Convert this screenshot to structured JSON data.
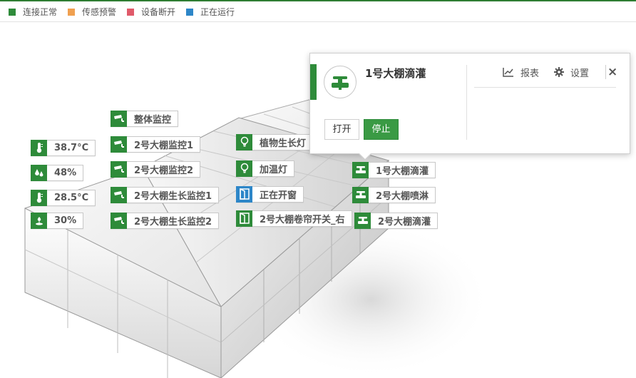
{
  "legend": [
    {
      "label": "连接正常",
      "color": "#2e8b3a"
    },
    {
      "label": "传感预警",
      "color": "#f0a050"
    },
    {
      "label": "设备断开",
      "color": "#e05a6a"
    },
    {
      "label": "正在运行",
      "color": "#2d86c8"
    }
  ],
  "sensors": {
    "temp1": {
      "value": "38.7°C",
      "icon": "thermometer-icon"
    },
    "hum1": {
      "value": "48%",
      "icon": "water-drops-icon"
    },
    "temp2": {
      "value": "28.5°C",
      "icon": "thermometer-icon"
    },
    "soil": {
      "value": "30%",
      "icon": "plant-moisture-icon"
    }
  },
  "monitors": {
    "overall": "整体监控",
    "m1": "2号大棚监控1",
    "m2": "2号大棚监控2",
    "g1": "2号大棚生长监控1",
    "g2": "2号大棚生长监控2"
  },
  "devices": {
    "plant_light": "植物生长灯",
    "heat_lamp": "加温灯",
    "window": "正在开窗",
    "curtain": "2号大棚卷帘开关_右",
    "drip1": "1号大棚滴灌",
    "spray2": "2号大棚喷淋",
    "drip2": "2号大棚滴灌"
  },
  "popup": {
    "title": "1号大棚滴灌",
    "report": "报表",
    "settings": "设置",
    "close": "×",
    "open_btn": "打开",
    "stop_btn": "停止",
    "icon": "faucet-icon"
  }
}
